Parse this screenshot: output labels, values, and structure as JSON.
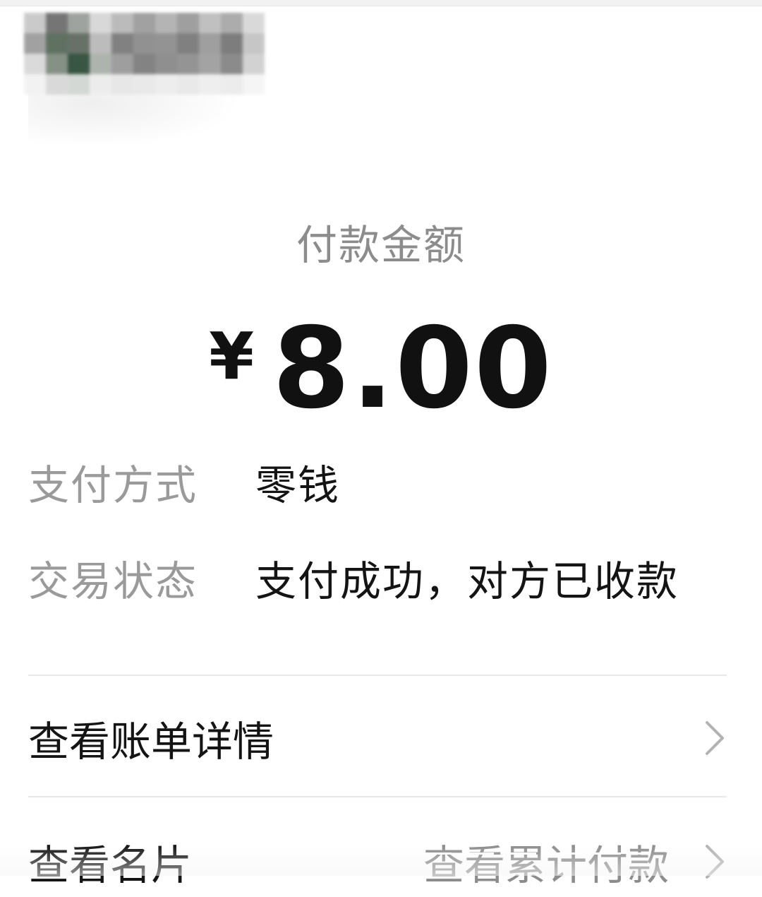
{
  "merchant": {
    "name_pixelated": true
  },
  "payment": {
    "amount_label": "付款金额",
    "currency_symbol": "¥",
    "amount": "8.00"
  },
  "details": {
    "method_label": "支付方式",
    "method_value": "零钱",
    "status_label": "交易状态",
    "status_value": "支付成功，对方已收款"
  },
  "menu": {
    "bill_details": "查看账单详情",
    "view_card": "查看名片",
    "cumulative_payment": "查看累计付款"
  },
  "icons": {
    "chevron": "chevron-right-icon"
  },
  "colors": {
    "label_gray": "#9a9a9a",
    "text_dark": "#141414",
    "divider": "#e8e8e8"
  }
}
